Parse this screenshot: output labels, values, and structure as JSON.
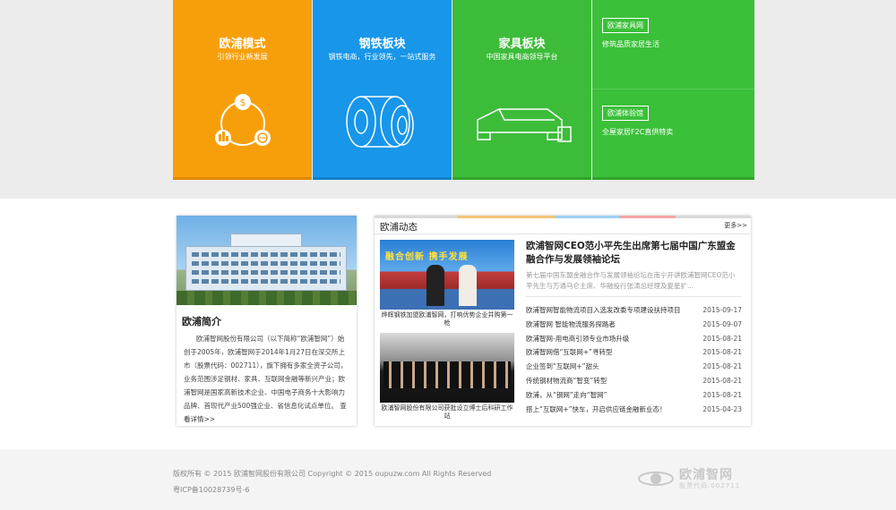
{
  "tiles": [
    {
      "title": "欧浦模式",
      "subtitle": "引领行业新发展"
    },
    {
      "title": "钢铁板块",
      "subtitle": "钢铁电商，行业领先，一站式服务"
    },
    {
      "title": "家具板块",
      "subtitle": "中国家具电商领导平台"
    }
  ],
  "side_tiles": [
    {
      "tag": "欧浦家具网",
      "desc": "修筑品质家居生活"
    },
    {
      "tag": "欧浦体验馆",
      "desc": "全屋家居F2C直供特卖"
    }
  ],
  "intro": {
    "title": "欧浦简介",
    "text": "欧浦智网股份有限公司（以下简称“欧浦智网”）始创于2005年，欧浦智网于2014年1月27日在深交所上市（股票代码：002711），旗下拥有多家全资子公司，业务范围涉足钢材、家具、互联网金融等新兴产业；欧浦智网是国家高新技术企业、中国电子商务十大影响力品牌、首现代产业500强企业、省信息化试点单位。",
    "more": "查看详情>>"
  },
  "news": {
    "title": "欧浦动态",
    "more": "更多>>",
    "thumbs": [
      {
        "banner": "融合创新 携手发展",
        "caption": "烨辉钢铁加盟欧浦智网，打响优势企业并购第一枪"
      },
      {
        "caption": "欧浦智网股份有限公司获批设立博士后科研工作站"
      }
    ],
    "featured": {
      "title": "欧浦智网CEO范小平先生出席第七届中国广东盟金融合作与发展领袖论坛",
      "desc": "第七届中国东盟金融合作与发展领袖论坛在南宁开讲欧浦智网CEO范小平先生与万通马仑主席、华融投行张涛总经理及复星扩..."
    },
    "items": [
      {
        "text": "欧浦智网智能物流项目入选发改委专项建设扶持项目",
        "date": "2015-09-17"
      },
      {
        "text": "欧浦智网 智能物流服务探路者",
        "date": "2015-09-07"
      },
      {
        "text": "欧浦智网-用电商引领专业市场升级",
        "date": "2015-08-21"
      },
      {
        "text": "欧浦智网借“互联网+”寻转型",
        "date": "2015-08-21"
      },
      {
        "text": "企业签到“互联网+”甜头",
        "date": "2015-08-21"
      },
      {
        "text": "传统钢材物流商“智变”转型",
        "date": "2015-08-21"
      },
      {
        "text": "欧浦，从“钢网”走向“智网”",
        "date": "2015-08-21"
      },
      {
        "text": "搭上“互联网+”快车，开启供应链金融新业态！",
        "date": "2015-04-23"
      }
    ]
  },
  "footer": {
    "copyright": "版权所有 © 2015 欧浦智网股份有限公司 Copyright © 2015 oupuzw.com All Rights Reserved",
    "icp": "粤ICP备10028739号-6",
    "logo_name": "欧浦智网",
    "logo_code": "股票代码:002711"
  },
  "colors": {
    "orange": "#f79f0b",
    "blue": "#1796ea",
    "green": "#3dbc3a"
  }
}
